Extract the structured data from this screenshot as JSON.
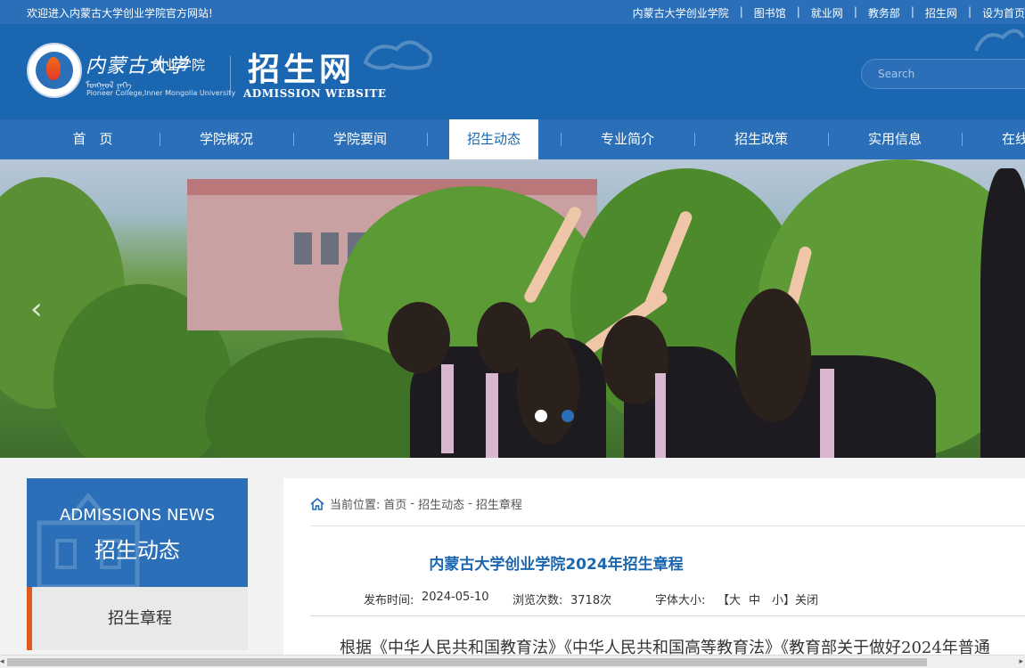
{
  "topbar": {
    "welcome": "欢迎进入内蒙古大学创业学院官方网站!",
    "links": [
      "内蒙古大学创业学院",
      "图书馆",
      "就业网",
      "教务部",
      "招生网",
      "设为首页"
    ]
  },
  "header": {
    "college_cn": "内蒙古大学",
    "college_sub": "创业学院",
    "college_en": "Pioneer College,Inner Mongolia University",
    "site_cn": "招生网",
    "site_en": "ADMISSION WEBSITE",
    "search_placeholder": "Search"
  },
  "nav": {
    "items": [
      "首　页",
      "学院概况",
      "学院要闻",
      "招生动态",
      "专业简介",
      "招生政策",
      "实用信息",
      "在线"
    ],
    "active_index": 3
  },
  "banner": {
    "slide_count": 2,
    "active_slide": 1
  },
  "sidebar": {
    "title_en": "ADMISSIONS NEWS",
    "title_cn": "招生动态",
    "items": [
      "招生章程"
    ]
  },
  "breadcrumb": {
    "label": "当前位置:",
    "path": [
      "首页",
      "-",
      "招生动态",
      "-",
      "招生章程"
    ]
  },
  "article": {
    "title": "内蒙古大学创业学院2024年招生章程",
    "publish_label": "发布时间:",
    "publish_date": "2024-05-10",
    "views_label": "浏览次数:",
    "views": "3718次",
    "font_label": "字体大小:",
    "font_large": "【大",
    "font_medium": "中",
    "font_small": "小】",
    "close": "关闭",
    "body_first_line": "根据《中华人民共和国教育法》《中华人民共和国高等教育法》《教育部关于做好2024年普通"
  },
  "colors": {
    "primary": "#1b66b1",
    "nav": "#2a6fb7",
    "accent": "#e05a1a"
  }
}
